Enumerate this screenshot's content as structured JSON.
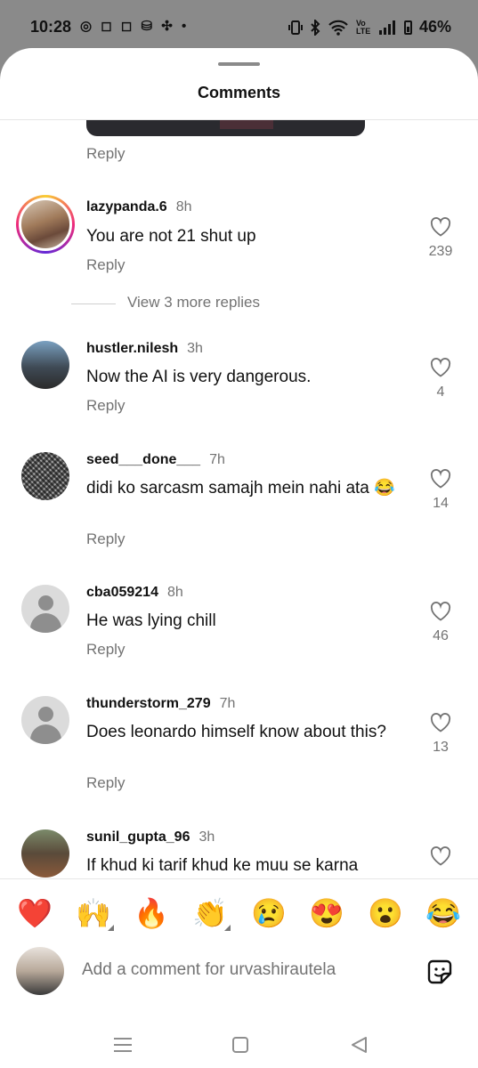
{
  "status_bar": {
    "time": "10:28",
    "app_icons": "◎ ◻ ◻ ⛁ ✣ •",
    "network": "Vo LTE",
    "battery": "46%"
  },
  "sheet": {
    "title": "Comments"
  },
  "top_reply_label": "Reply",
  "comments": [
    {
      "username": "lazypanda.6",
      "time": "8h",
      "text": "You are not 21 shut up",
      "reply_label": "Reply",
      "likes": "239",
      "view_more": "View 3 more replies"
    },
    {
      "username": "hustler.nilesh",
      "time": "3h",
      "text": "Now the AI is very dangerous.",
      "reply_label": "Reply",
      "likes": "4"
    },
    {
      "username": "seed___done___",
      "time": "7h",
      "text": "didi ko sarcasm samajh mein nahi ata 😂",
      "reply_label": "Reply",
      "likes": "14"
    },
    {
      "username": "cba059214",
      "time": "8h",
      "text": "He was lying chill",
      "reply_label": "Reply",
      "likes": "46"
    },
    {
      "username": "thunderstorm_279",
      "time": "7h",
      "text": "Does leonardo himself know about this?",
      "reply_label": "Reply",
      "likes": "13"
    },
    {
      "username": "sunil_gupta_96",
      "time": "3h",
      "text": "If khud ki tarif khud ke muu se karna",
      "likes": ""
    }
  ],
  "emoji_bar": [
    "❤️",
    "🙌",
    "🔥",
    "👏",
    "😢",
    "😍",
    "😮",
    "😂"
  ],
  "comment_box": {
    "placeholder": "Add a comment for urvashirautela"
  },
  "icons": {
    "like": "heart-outline-icon",
    "sticker": "sticker-icon",
    "nav_recents": "menu-lines-icon",
    "nav_home": "square-icon",
    "nav_back": "triangle-back-icon"
  },
  "colors": {
    "secondary_text": "#737373",
    "primary_text": "#111111",
    "sheet_bg": "#ffffff",
    "backdrop": "#8a8a8a"
  }
}
